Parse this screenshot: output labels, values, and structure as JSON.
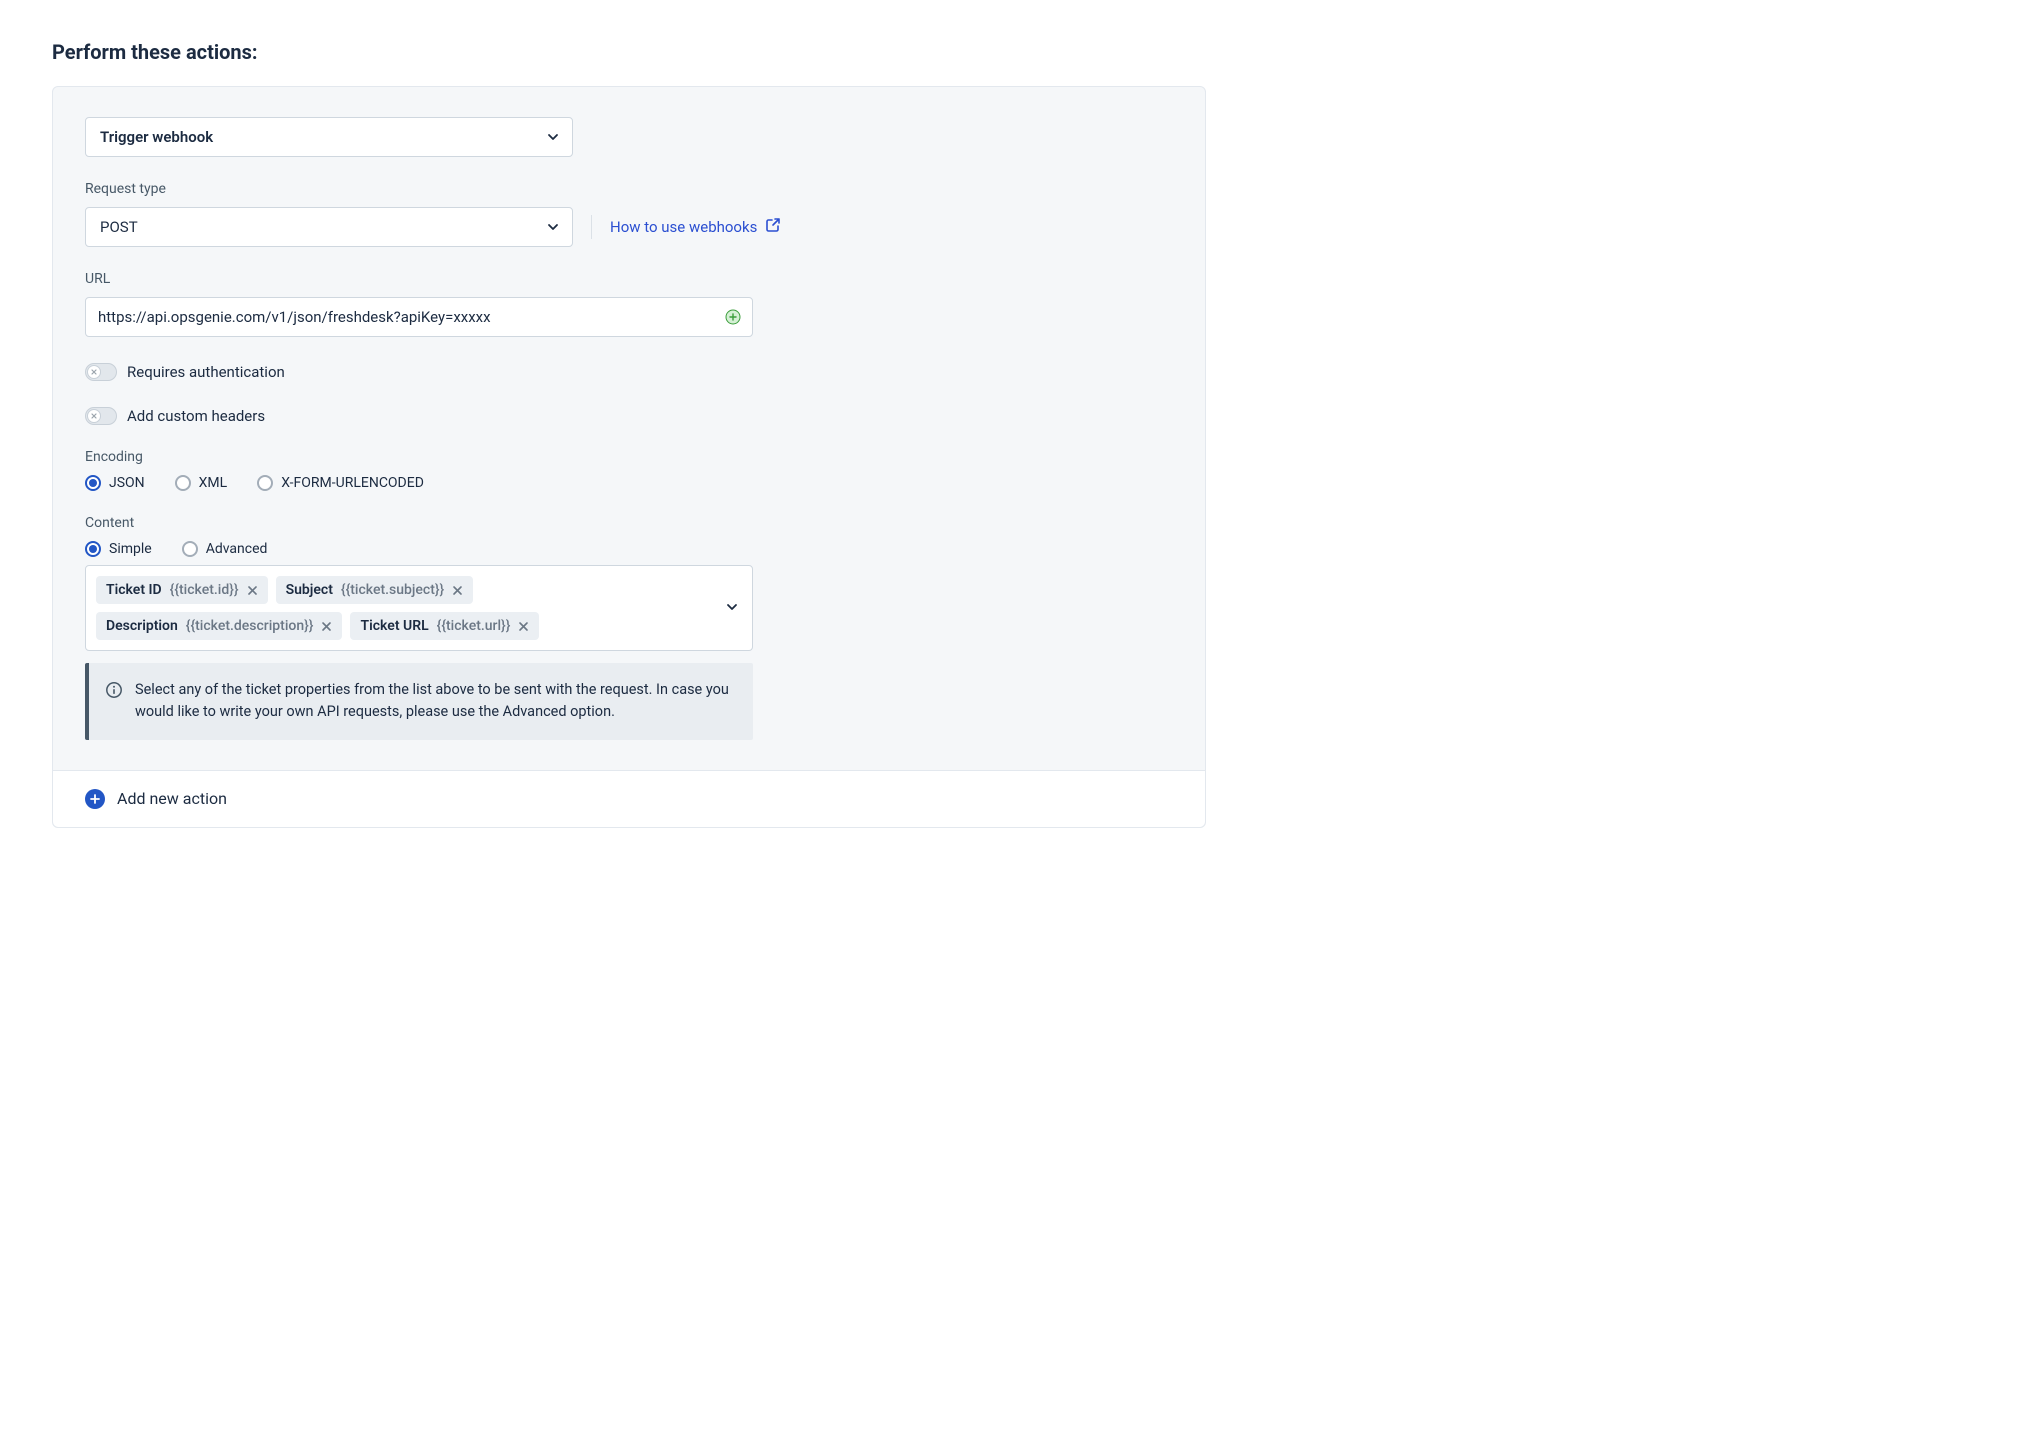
{
  "header": {
    "title": "Perform these actions:"
  },
  "action": {
    "type_label": "Trigger webhook",
    "request_type_label": "Request type",
    "request_type_value": "POST",
    "help_link_text": "How to use webhooks",
    "url_label": "URL",
    "url_value": "https://api.opsgenie.com/v1/json/freshdesk?apiKey=xxxxx",
    "toggles": {
      "requires_auth": "Requires authentication",
      "custom_headers": "Add custom headers"
    },
    "encoding": {
      "label": "Encoding",
      "options": {
        "json": "JSON",
        "xml": "XML",
        "xform": "X-FORM-URLENCODED"
      }
    },
    "content": {
      "label": "Content",
      "simple": "Simple",
      "advanced": "Advanced",
      "chips": [
        {
          "name": "Ticket ID",
          "var": "{{ticket.id}}"
        },
        {
          "name": "Subject",
          "var": "{{ticket.subject}}"
        },
        {
          "name": "Description",
          "var": "{{ticket.description}}"
        },
        {
          "name": "Ticket URL",
          "var": "{{ticket.url}}"
        }
      ],
      "info_text": "Select any of the ticket properties from the list above to be sent with the request. In case you would like to write your own API requests, please use the Advanced option."
    }
  },
  "footer": {
    "add_action": "Add new action"
  }
}
